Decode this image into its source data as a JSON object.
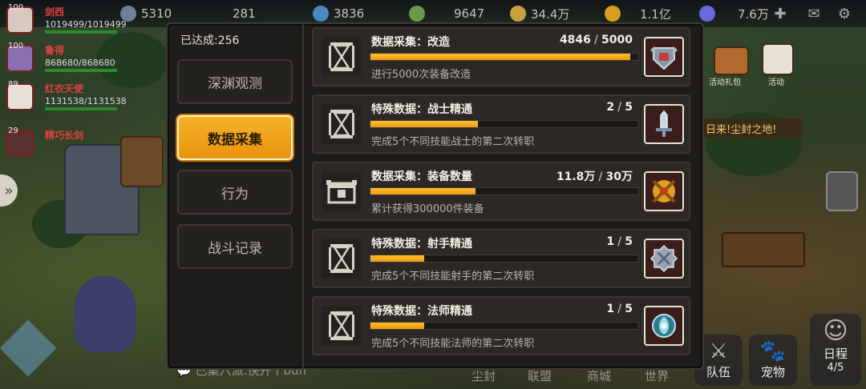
{
  "resources": [
    {
      "value": "5310",
      "color": "#6f7f9a"
    },
    {
      "value": "281",
      "color": "#8a8a8a"
    },
    {
      "value": "3836",
      "color": "#4a8ac0"
    },
    {
      "value": "9647",
      "color": "#6a9a4a"
    },
    {
      "value": "34.4万",
      "color": "#c8a040"
    },
    {
      "value": "1.1亿",
      "color": "#d4a020"
    },
    {
      "value": "7.6万",
      "color": "#6a6ae0"
    }
  ],
  "party": [
    {
      "level": "100",
      "name": "剑西",
      "hp": "1019499/1019499"
    },
    {
      "level": "100",
      "name": "鲁得",
      "hp": "868680/868680"
    },
    {
      "level": "89",
      "name": "红衣天使",
      "hp": "1131538/1131538"
    },
    {
      "level": "29",
      "name": "精巧长剑",
      "hp": ""
    }
  ],
  "chat_text": "已集六派:快开个buff",
  "bottom_nav": [
    "尘封",
    "联盟",
    "商城",
    "世界"
  ],
  "right_buttons": [
    {
      "label": "队伍",
      "icon": "team"
    },
    {
      "label": "宠物",
      "icon": "paw"
    },
    {
      "label": "日程",
      "sub": "4/5",
      "icon": "schedule"
    }
  ],
  "right_side_labels": {
    "gift": "活动礼包",
    "activity": "活动",
    "banner": "日来!尘封之地!"
  },
  "dialog": {
    "achieved": "已达成:256",
    "tabs": [
      {
        "label": "深渊观测",
        "active": false
      },
      {
        "label": "数据采集",
        "active": true
      },
      {
        "label": "行为",
        "active": false
      },
      {
        "label": "战斗记录",
        "active": false
      }
    ],
    "achievements": [
      {
        "title": "数据采集：改造",
        "current": "4846",
        "total": "5000",
        "progress": 0.969,
        "desc": "进行5000次装备改造",
        "icon": "hourglass",
        "badge": "shield-badge",
        "badge_color": "#3a1e1c"
      },
      {
        "title": "特殊数据：战士精通",
        "current": "2",
        "total": "5",
        "progress": 0.4,
        "desc": "完成5个不同技能战士的第二次转职",
        "icon": "hourglass",
        "badge": "sword-badge",
        "badge_color": "#3a1e1c"
      },
      {
        "title": "数据采集：装备数量",
        "current": "11.8万",
        "total": "30万",
        "progress": 0.393,
        "desc": "累计获得300000件装备",
        "icon": "chest",
        "badge": "crossed-swords-badge",
        "badge_color": "#3a1e1c"
      },
      {
        "title": "特殊数据：射手精通",
        "current": "1",
        "total": "5",
        "progress": 0.2,
        "desc": "完成5个不同技能射手的第二次转职",
        "icon": "hourglass",
        "badge": "gear-badge",
        "badge_color": "#3a1e1c"
      },
      {
        "title": "特殊数据：法师精通",
        "current": "1",
        "total": "5",
        "progress": 0.2,
        "desc": "完成5个不同技能法师的第二次转职",
        "icon": "hourglass",
        "badge": "orb-badge",
        "badge_color": "#3a1e1c"
      }
    ]
  }
}
